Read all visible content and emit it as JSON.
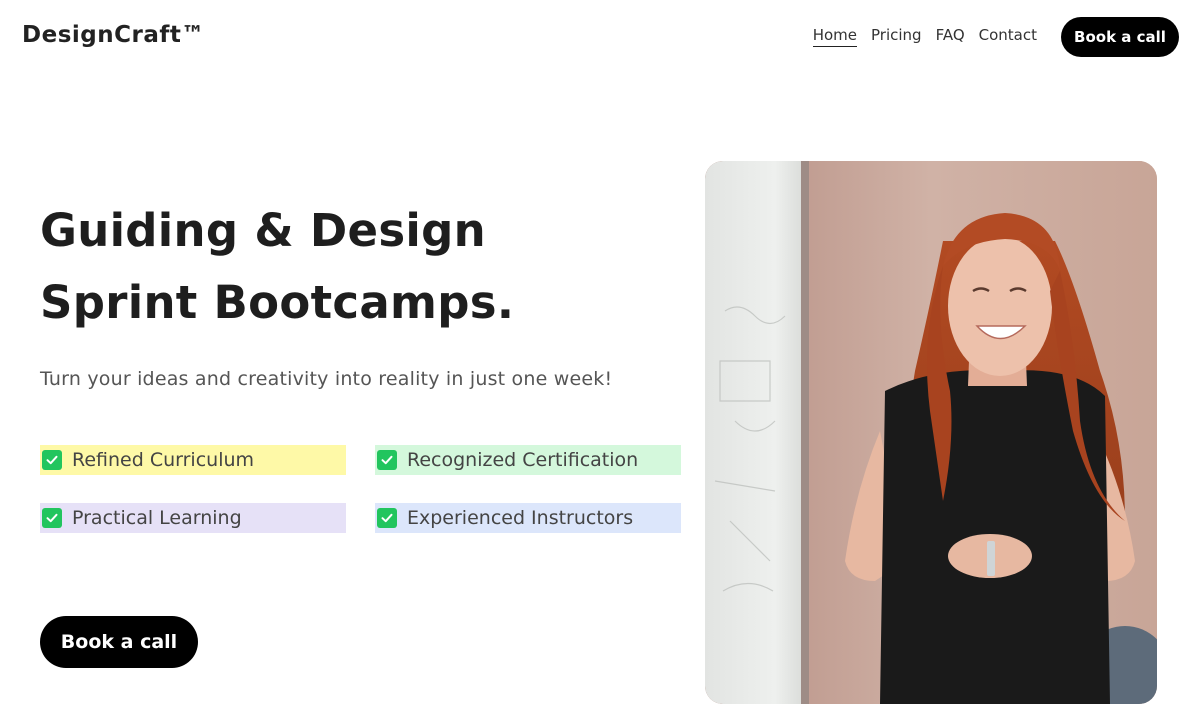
{
  "header": {
    "logo": "DesignCraft™",
    "nav": [
      {
        "label": "Home",
        "active": true
      },
      {
        "label": "Pricing",
        "active": false
      },
      {
        "label": "FAQ",
        "active": false
      },
      {
        "label": "Contact",
        "active": false
      }
    ],
    "cta_label": "Book a call"
  },
  "hero": {
    "headline_line1": "Guiding & Design",
    "headline_line2": "Sprint Bootcamps.",
    "subtitle": "Turn your ideas and creativity into reality in just one week!",
    "features": [
      {
        "label": "Refined Curriculum",
        "color": "#fef9a7"
      },
      {
        "label": "Recognized Certification",
        "color": "#d4f8dc"
      },
      {
        "label": "Practical Learning",
        "color": "#e6e1f7"
      },
      {
        "label": "Experienced Instructors",
        "color": "#dce6fb"
      }
    ],
    "cta_label": "Book a call",
    "check_color": "#22c55e"
  },
  "image": {
    "subject": "smiling woman with long red hair in black sleeveless top standing by a whiteboard"
  }
}
